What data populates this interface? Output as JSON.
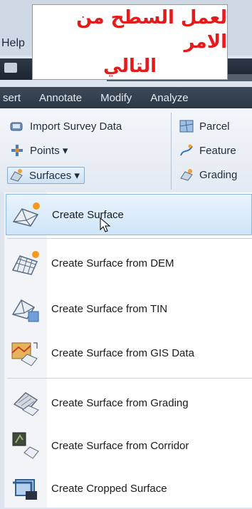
{
  "annotation": {
    "line1": "لعمل السطح من الامر",
    "line2": "التالي"
  },
  "menu": {
    "help_label": "Help"
  },
  "ribbon": {
    "tabs": [
      "sert",
      "Annotate",
      "Modify",
      "Analyze"
    ],
    "items": {
      "import_survey": "Import Survey Data",
      "points": "Points ▾",
      "surfaces": "Surfaces ▾",
      "parcel": "Parcel",
      "feature": "Feature",
      "grading": "Grading"
    }
  },
  "surfaces_menu": {
    "items": [
      {
        "label": "Create Surface",
        "icon": "create-surface-icon"
      },
      {
        "label": "Create Surface from DEM",
        "icon": "surface-dem-icon"
      },
      {
        "label": "Create Surface from TIN",
        "icon": "surface-tin-icon"
      },
      {
        "label": "Create Surface from GIS Data",
        "icon": "surface-gis-icon"
      },
      {
        "label": "Create Surface from Grading",
        "icon": "surface-grading-icon"
      },
      {
        "label": "Create Surface from Corridor",
        "icon": "surface-corridor-icon"
      },
      {
        "label": "Create Cropped Surface",
        "icon": "cropped-surface-icon"
      }
    ],
    "active_index": 0
  },
  "colors": {
    "annotation_text": "#e41b1b",
    "highlight": "#cfe5fa"
  }
}
